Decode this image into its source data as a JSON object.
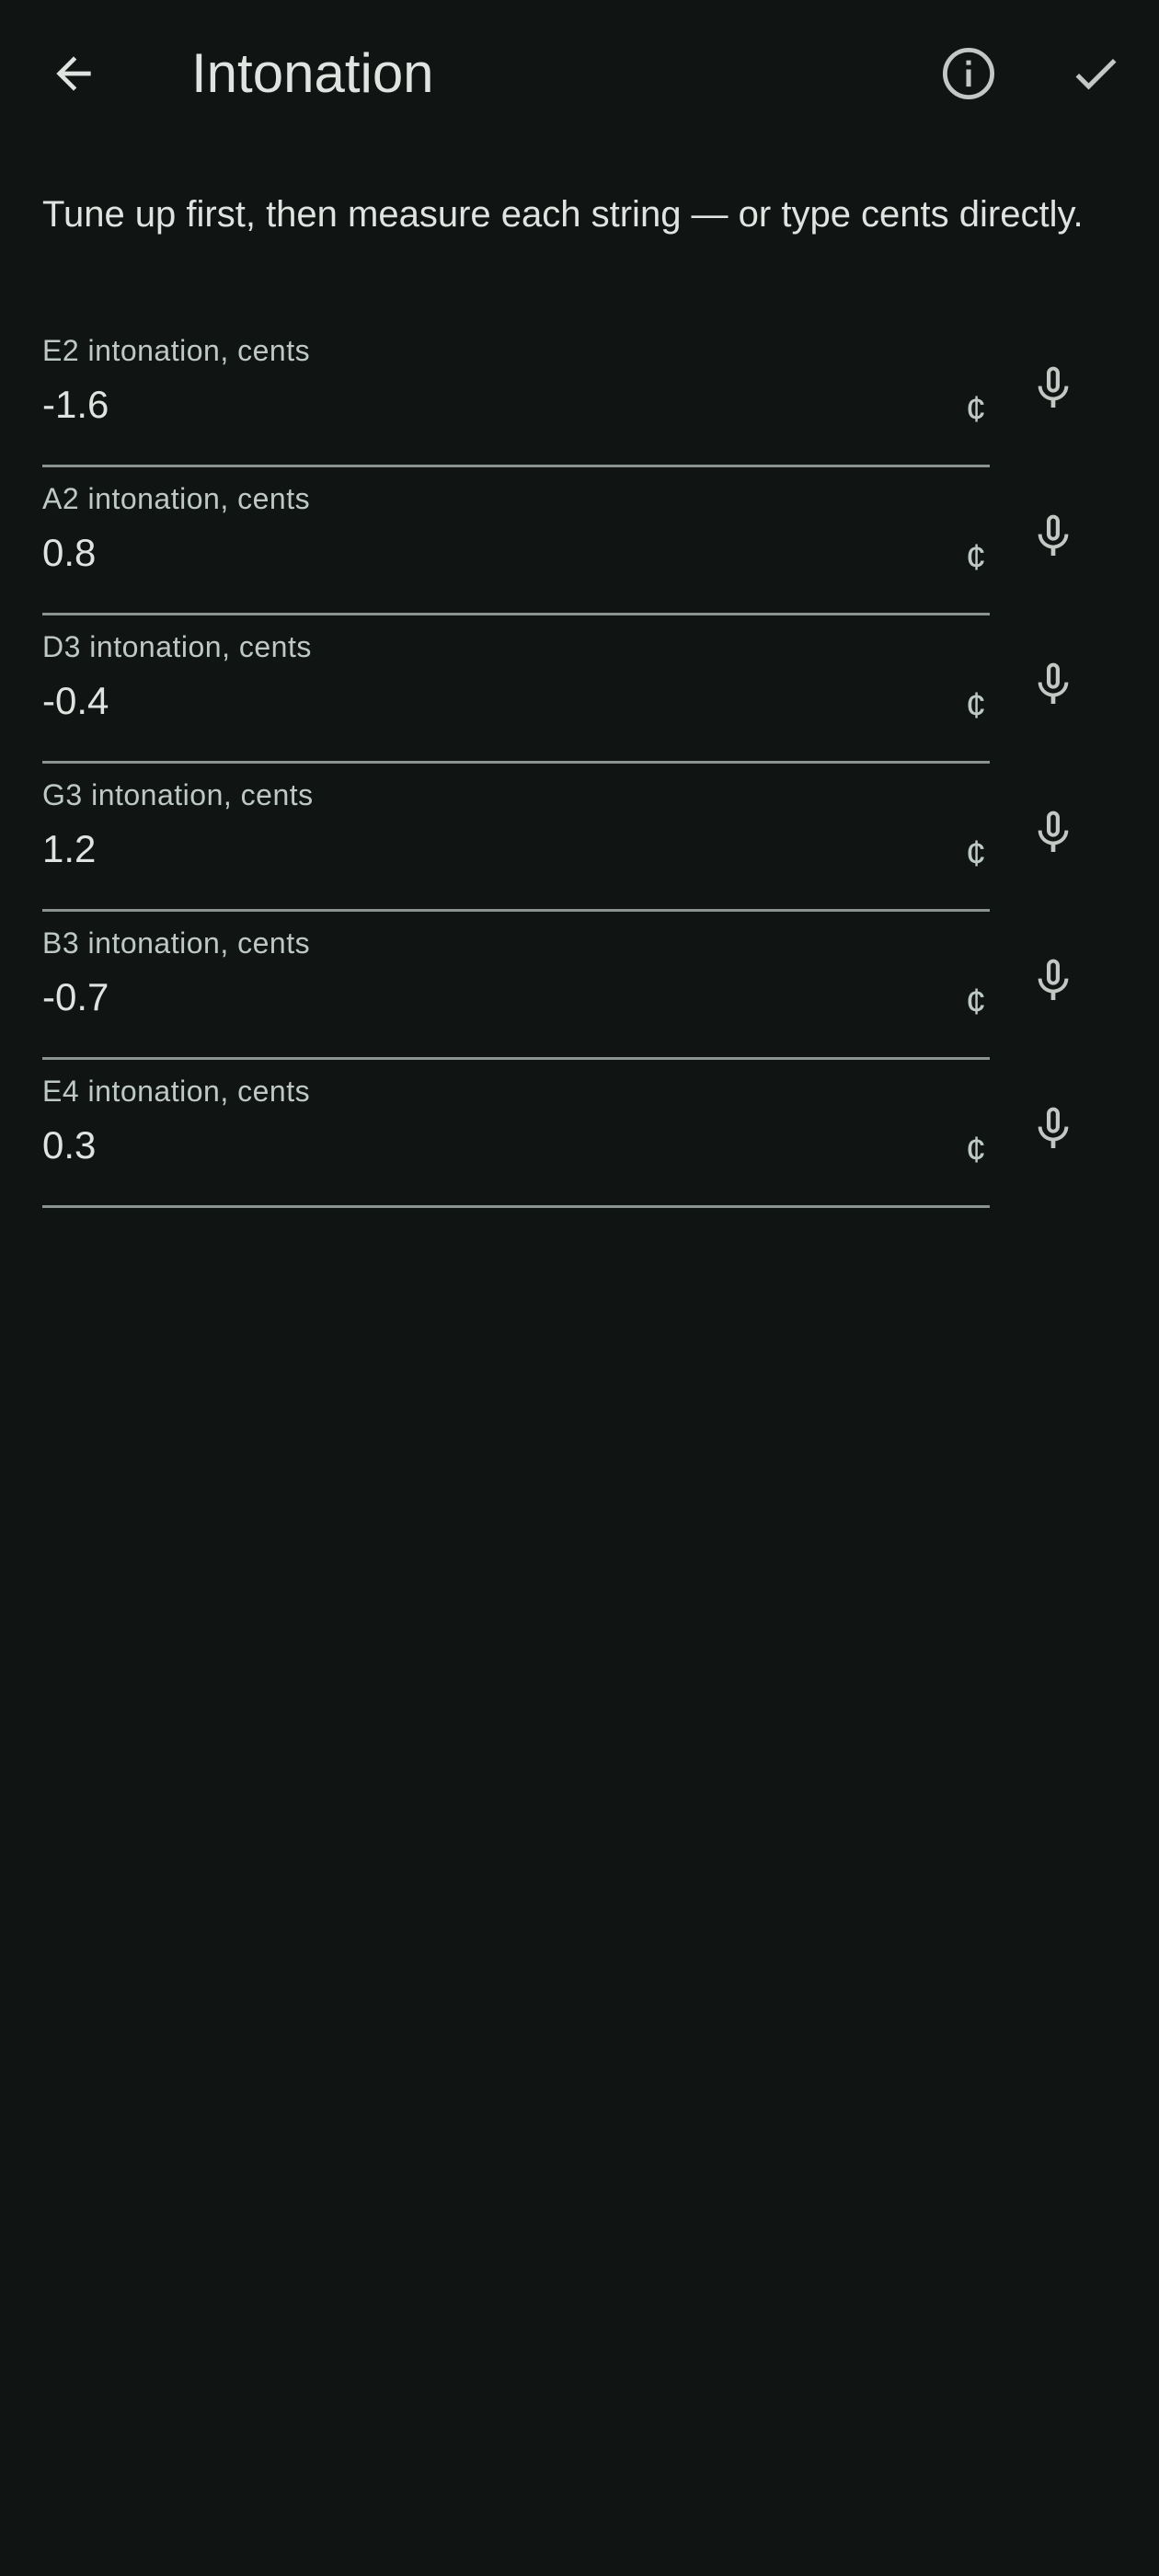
{
  "app_bar": {
    "title": "Intonation",
    "icons": {
      "back": "arrow-back-icon",
      "info": "info-icon",
      "done": "check-icon"
    }
  },
  "intro_text": "Tune up first, then measure each string — or type cents directly.",
  "strings": [
    {
      "label": "E2 intonation, cents",
      "value": "-1.6",
      "suffix": "¢",
      "icon": "microphone-icon"
    },
    {
      "label": "A2 intonation, cents",
      "value": "0.8",
      "suffix": "¢",
      "icon": "microphone-icon"
    },
    {
      "label": "D3 intonation, cents",
      "value": "-0.4",
      "suffix": "¢",
      "icon": "microphone-icon"
    },
    {
      "label": "G3 intonation, cents",
      "value": "1.2",
      "suffix": "¢",
      "icon": "microphone-icon"
    },
    {
      "label": "B3 intonation, cents",
      "value": "-0.7",
      "suffix": "¢",
      "icon": "microphone-icon"
    },
    {
      "label": "E4 intonation, cents",
      "value": "0.3",
      "suffix": "¢",
      "icon": "microphone-icon"
    }
  ],
  "colors": {
    "background": "#101514",
    "text_primary": "#e1e3e0",
    "text_secondary": "#bfc9c4",
    "underline": "#8a938f"
  }
}
